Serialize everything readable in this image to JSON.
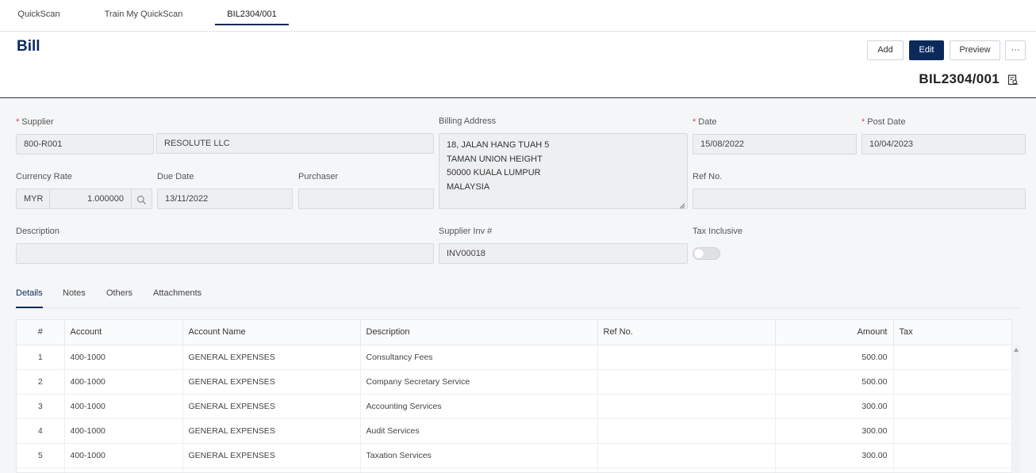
{
  "top_tabs": [
    {
      "label": "QuickScan"
    },
    {
      "label": "Train My QuickScan"
    },
    {
      "label": "BIL2304/001"
    }
  ],
  "header": {
    "title": "Bill",
    "doc_number": "BIL2304/001",
    "buttons": {
      "add": "Add",
      "edit": "Edit",
      "preview": "Preview",
      "more": "···"
    }
  },
  "form": {
    "supplier": {
      "label": "Supplier",
      "code": "800-R001",
      "name": "RESOLUTE LLC"
    },
    "billing_address": {
      "label": "Billing Address",
      "lines": [
        "18, JALAN HANG TUAH 5",
        "TAMAN UNION HEIGHT",
        "50000 KUALA LUMPUR",
        "MALAYSIA"
      ]
    },
    "date": {
      "label": "Date",
      "value": "15/08/2022"
    },
    "post_date": {
      "label": "Post Date",
      "value": "10/04/2023"
    },
    "currency_rate": {
      "label": "Currency Rate",
      "currency": "MYR",
      "rate": "1.000000"
    },
    "due_date": {
      "label": "Due Date",
      "value": "13/11/2022"
    },
    "purchaser": {
      "label": "Purchaser",
      "value": ""
    },
    "ref_no": {
      "label": "Ref No.",
      "value": ""
    },
    "description": {
      "label": "Description",
      "value": ""
    },
    "supplier_inv": {
      "label": "Supplier Inv #",
      "value": "INV00018"
    },
    "tax_inclusive": {
      "label": "Tax Inclusive",
      "on": false
    }
  },
  "sub_tabs": [
    {
      "label": "Details"
    },
    {
      "label": "Notes"
    },
    {
      "label": "Others"
    },
    {
      "label": "Attachments"
    }
  ],
  "table": {
    "columns": [
      "#",
      "Account",
      "Account Name",
      "Description",
      "Ref No.",
      "Amount",
      "Tax"
    ],
    "rows": [
      {
        "no": "1",
        "account": "400-1000",
        "account_name": "GENERAL EXPENSES",
        "description": "Consultancy Fees",
        "ref_no": "",
        "amount": "500.00",
        "tax": ""
      },
      {
        "no": "2",
        "account": "400-1000",
        "account_name": "GENERAL EXPENSES",
        "description": "Company Secretary Service",
        "ref_no": "",
        "amount": "500.00",
        "tax": ""
      },
      {
        "no": "3",
        "account": "400-1000",
        "account_name": "GENERAL EXPENSES",
        "description": "Accounting Services",
        "ref_no": "",
        "amount": "300.00",
        "tax": ""
      },
      {
        "no": "4",
        "account": "400-1000",
        "account_name": "GENERAL EXPENSES",
        "description": "Audit Services",
        "ref_no": "",
        "amount": "300.00",
        "tax": ""
      },
      {
        "no": "5",
        "account": "400-1000",
        "account_name": "GENERAL EXPENSES",
        "description": "Taxation Services",
        "ref_no": "",
        "amount": "300.00",
        "tax": ""
      },
      {
        "no": "",
        "account": "",
        "account_name": "",
        "description": "",
        "ref_no": "",
        "amount": "",
        "tax": ""
      }
    ]
  },
  "icons": {
    "search": "search-icon",
    "document": "document-search-icon",
    "grip": "resize-grip-icon",
    "scroll_up": "scroll-up-arrow-icon"
  },
  "colors": {
    "primary": "#0b2a5b",
    "required": "#e0433a",
    "form_bg": "#f5f6f8",
    "field_bg": "#eeeff1"
  }
}
